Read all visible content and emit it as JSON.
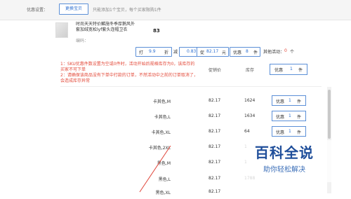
{
  "top": {
    "settings_label": "优惠设置：",
    "change_button": "更换宝贝",
    "hint": "只能添加1个宝贝，每个买家限购1件"
  },
  "product": {
    "title": "时尚天天特价麟施冬季厚鹅风外套加绒宽松lyf套头连帽卫衣",
    "price": "83",
    "code_label": "编码："
  },
  "discount": {
    "fold_label": "打",
    "fold_value": "9.9",
    "fold_unit": "折",
    "minus_label": "减",
    "minus_value": "0.83",
    "minus_unit": "元",
    "promo_label": "促",
    "promo_value": "82.17",
    "promo_unit": "元",
    "pref_label": "优惠",
    "pref_value": "8",
    "pref_unit": "件",
    "other_label": "其他活动：",
    "other_value": "0",
    "other_unit": "个"
  },
  "notice": {
    "line1": "1：SKU优惠件数设置为空或0件时，活动开始后规格库存为0，该库存的买家不可下单",
    "line2": "2：请确保该商品没有下单中打款的订单，不然活动中之前的订单取消了，会造成库存异常"
  },
  "table": {
    "price_header": "促销价",
    "stock_header": "库存",
    "header_pref": {
      "label": "优惠",
      "value": "1",
      "unit": "件"
    },
    "rows": [
      {
        "name": "卡其色,M",
        "price": "82.17",
        "stock": "1624",
        "pref_label": "优惠",
        "pref_value": "1",
        "pref_unit": "件"
      },
      {
        "name": "卡其色,L",
        "price": "82.17",
        "stock": "1634",
        "pref_label": "优惠",
        "pref_value": "1",
        "pref_unit": "件"
      },
      {
        "name": "卡其色,XL",
        "price": "82.17",
        "stock": "64",
        "pref_label": "优惠",
        "pref_value": "1",
        "pref_unit": "件"
      },
      {
        "name": "卡其色,2XL",
        "price": "82.17",
        "stock": "1",
        "pref_label": "",
        "pref_value": "",
        "pref_unit": ""
      },
      {
        "name": "黑色,M",
        "price": "82.17",
        "stock": "1",
        "pref_label": "",
        "pref_value": "",
        "pref_unit": ""
      },
      {
        "name": "黑色,L",
        "price": "82.17",
        "stock": "1788",
        "pref_label": "",
        "pref_value": "",
        "pref_unit": ""
      },
      {
        "name": "黑色,XL",
        "price": "82.17",
        "stock": "",
        "pref_label": "",
        "pref_value": "",
        "pref_unit": ""
      }
    ]
  },
  "watermark": {
    "title": "百科全说",
    "subtitle": "助你轻松解决"
  },
  "colors": {
    "accent_blue": "#2d6fd0",
    "notice_red": "#e34a3a",
    "annotation_red": "#e0463a"
  }
}
